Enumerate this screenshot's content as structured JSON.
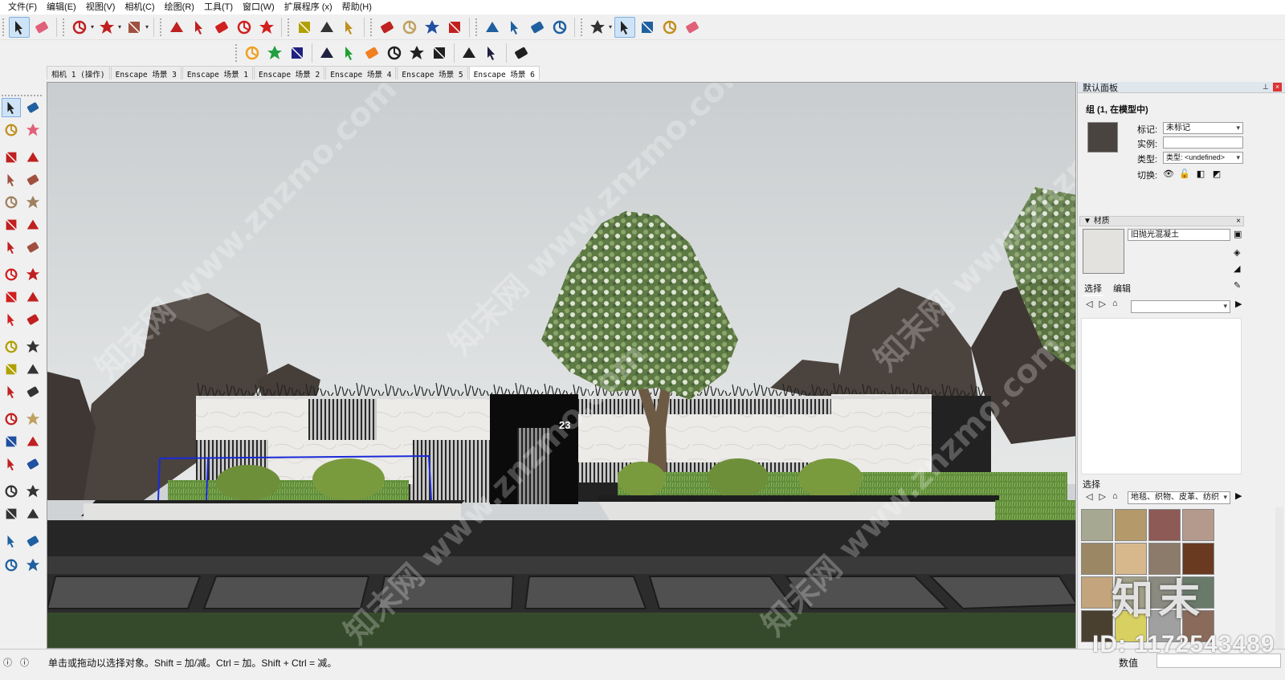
{
  "menu": [
    "文件(F)",
    "编辑(E)",
    "视图(V)",
    "相机(C)",
    "绘图(R)",
    "工具(T)",
    "窗口(W)",
    "扩展程序 (x)",
    "帮助(H)"
  ],
  "toolbar_top": [
    {
      "name": "select-icon",
      "color": "#222"
    },
    {
      "name": "eraser-icon",
      "color": "#e0607a"
    },
    {
      "name": "pencil-line-icon",
      "color": "#c02020"
    },
    {
      "name": "arc-icon",
      "color": "#c02020"
    },
    {
      "name": "rectangle-icon",
      "color": "#a05040"
    },
    {
      "name": "push-pull-icon",
      "color": "#c02020"
    },
    {
      "name": "follow-me-icon",
      "color": "#c02020"
    },
    {
      "name": "move-icon",
      "color": "#d02020"
    },
    {
      "name": "rotate-icon",
      "color": "#d02020"
    },
    {
      "name": "scale-icon",
      "color": "#d02020"
    },
    {
      "name": "tape-measure-icon",
      "color": "#b0a000"
    },
    {
      "name": "text-icon",
      "color": "#333"
    },
    {
      "name": "paint-bucket-icon",
      "color": "#c09020"
    },
    {
      "name": "orbit-icon",
      "color": "#c02020"
    },
    {
      "name": "pan-icon",
      "color": "#c0a060"
    },
    {
      "name": "zoom-icon",
      "color": "#2050a0"
    },
    {
      "name": "zoom-extents-icon",
      "color": "#c02020"
    },
    {
      "name": "warehouse-icon",
      "color": "#2060a0"
    },
    {
      "name": "extension-warehouse-icon",
      "color": "#2060a0"
    },
    {
      "name": "layers-icon",
      "color": "#2060a0"
    },
    {
      "name": "sandbox-icon",
      "color": "#2060a0"
    },
    {
      "name": "user-icon",
      "color": "#333"
    }
  ],
  "toolbar_enscape": [
    {
      "name": "enscape-start-icon",
      "color": "#f0a020"
    },
    {
      "name": "enscape-sync-icon",
      "color": "#20a040"
    },
    {
      "name": "enscape-views-icon",
      "color": "#202080"
    },
    {
      "name": "enscape-add-icon",
      "color": "#202040"
    },
    {
      "name": "enscape-tree-icon",
      "color": "#20a030"
    },
    {
      "name": "enscape-sun-icon",
      "color": "#f08020"
    },
    {
      "name": "enscape-material-icon",
      "color": "#202020"
    },
    {
      "name": "enscape-upload-icon",
      "color": "#202020"
    },
    {
      "name": "enscape-settings-icon",
      "color": "#202020"
    },
    {
      "name": "enscape-feedback-icon",
      "color": "#202020"
    },
    {
      "name": "enscape-about-icon",
      "color": "#202040"
    },
    {
      "name": "enscape-account-icon",
      "color": "#202020"
    }
  ],
  "scene_tabs": [
    "相机 1 (操作)",
    "Enscape 场景 3",
    "Enscape 场景 1",
    "Enscape 场景 2",
    "Enscape 场景 4",
    "Enscape 场景 5",
    "Enscape 场景 6"
  ],
  "active_scene": 6,
  "tray": {
    "title": "默认面板",
    "entity_info": {
      "header": "组 (1, 在模型中)",
      "tag_label": "标记:",
      "tag_value": "未标记",
      "instance_label": "实例:",
      "instance_value": "",
      "type_label": "类型:",
      "type_value": "类型: <undefined>",
      "toggle_label": "切换:",
      "swatch_color": "#4a4440"
    },
    "materials": {
      "section_title": "▼ 材质",
      "material_name": "旧抛光混凝土",
      "tab_select": "选择",
      "tab_edit": "编辑",
      "select_header": "选择",
      "library_value": "地毯、织物、皮革、纺织",
      "thumbs": [
        "#a7a891",
        "#b49a6a",
        "#8d5a56",
        "#b49a8c",
        "#9b8764",
        "#d7b88d",
        "#8c7a6a",
        "#6a3a20",
        "#c4a47c",
        "#a2a088",
        "#8a8a80",
        "#6a7a6a",
        "#4a4030",
        "#d8d060",
        "#a0a0a0",
        "#8a6a5a"
      ]
    }
  },
  "status": {
    "hint": "单击或拖动以选择对象。Shift = 加/减。Ctrl = 加。Shift + Ctrl = 减。",
    "value_label": "数值",
    "value": ""
  },
  "scene": {
    "house_number": "23"
  },
  "watermark": {
    "logo": "知末",
    "id_text": "ID: 1172543489",
    "site": "知末网 www.znzmo.com"
  }
}
